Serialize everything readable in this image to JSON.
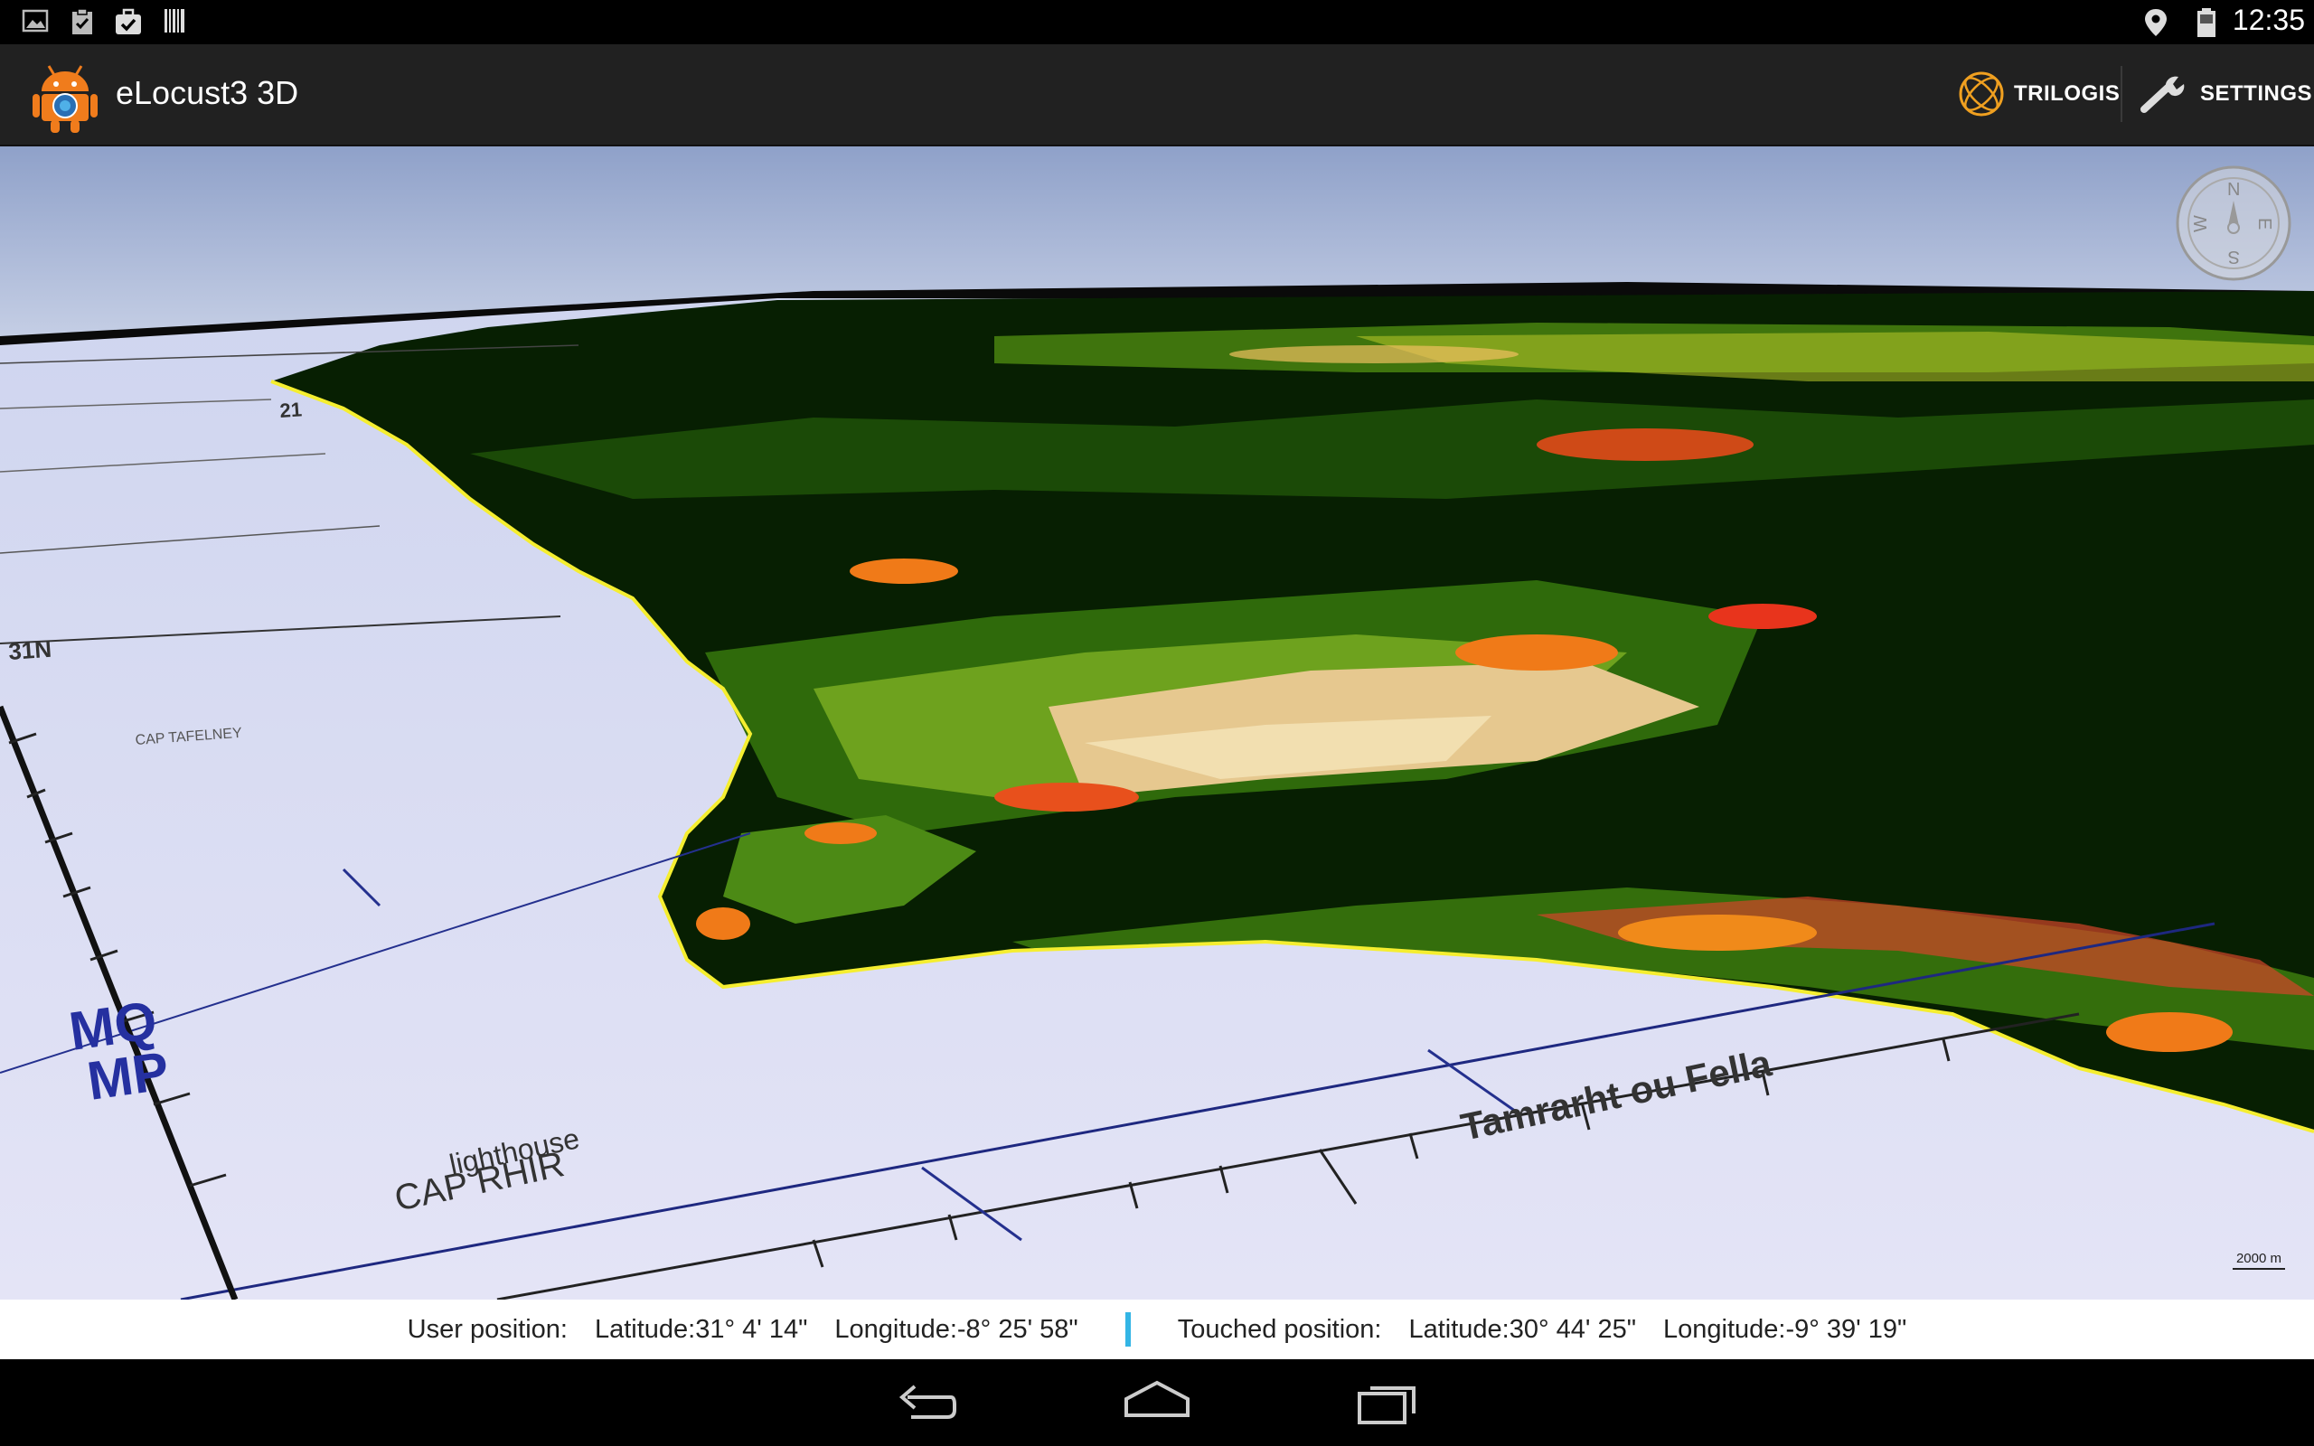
{
  "status_bar": {
    "time": "12:35",
    "left_icons": [
      "gallery-icon",
      "clipboard-check-icon",
      "briefcase-check-icon",
      "barcode-icon"
    ],
    "right_icons": [
      "location-icon",
      "battery-icon"
    ]
  },
  "action_bar": {
    "title": "eLocust3 3D",
    "actions": [
      {
        "label": "TRILOGIS",
        "icon": "trilogis-globe-icon"
      },
      {
        "label": "SETTINGS",
        "icon": "wrench-icon"
      }
    ]
  },
  "map": {
    "labels": {
      "cap_tafelney": "CAP TAFELNEY",
      "lat_31n": "31N",
      "mq": "MQ",
      "mp": "MP",
      "lighthouse": "lighthouse",
      "cap_rhir": "CAP RHIR",
      "tamrarht": "Tamrarht ou Fella",
      "num_21": "21"
    },
    "compass": {
      "n": "N",
      "e": "E",
      "s": "S",
      "w": "W"
    },
    "scale_label": "2000 m"
  },
  "info_bar": {
    "user_label": "User position:",
    "user_lat": "Latitude:31° 4' 14\"",
    "user_lon": "Longitude:-8° 25' 58\"",
    "touched_label": "Touched position:",
    "touched_lat": "Latitude:30° 44' 25\"",
    "touched_lon": "Longitude:-9° 39' 19\""
  },
  "nav_bar": {
    "buttons": [
      "back-icon",
      "home-icon",
      "recent-apps-icon"
    ]
  }
}
